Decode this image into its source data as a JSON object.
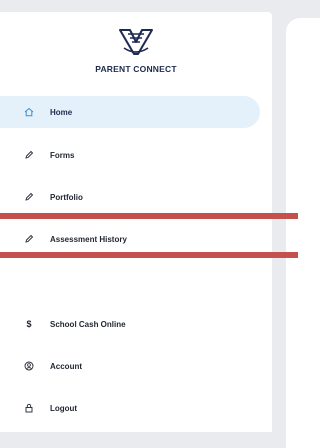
{
  "brand": {
    "name": "PARENT CONNECT",
    "logo_icon": "parent-connect-logo",
    "color": "#1e2b4f"
  },
  "nav": {
    "items": [
      {
        "label": "Home",
        "icon": "home-icon",
        "active": true
      },
      {
        "label": "Forms",
        "icon": "pencil-icon",
        "active": false
      },
      {
        "label": "Portfolio",
        "icon": "pencil-icon",
        "active": false
      },
      {
        "label": "Assessment History",
        "icon": "pencil-icon",
        "active": false
      },
      {
        "label": "School Cash Online",
        "icon": "dollar-icon",
        "active": false
      },
      {
        "label": "Account",
        "icon": "account-icon",
        "active": false
      },
      {
        "label": "Logout",
        "icon": "lock-icon",
        "active": false
      }
    ],
    "active_bg": "#e4f1fb",
    "accent": "#3a8fd0"
  },
  "overlay": {
    "bar_color": "#c4514d"
  }
}
